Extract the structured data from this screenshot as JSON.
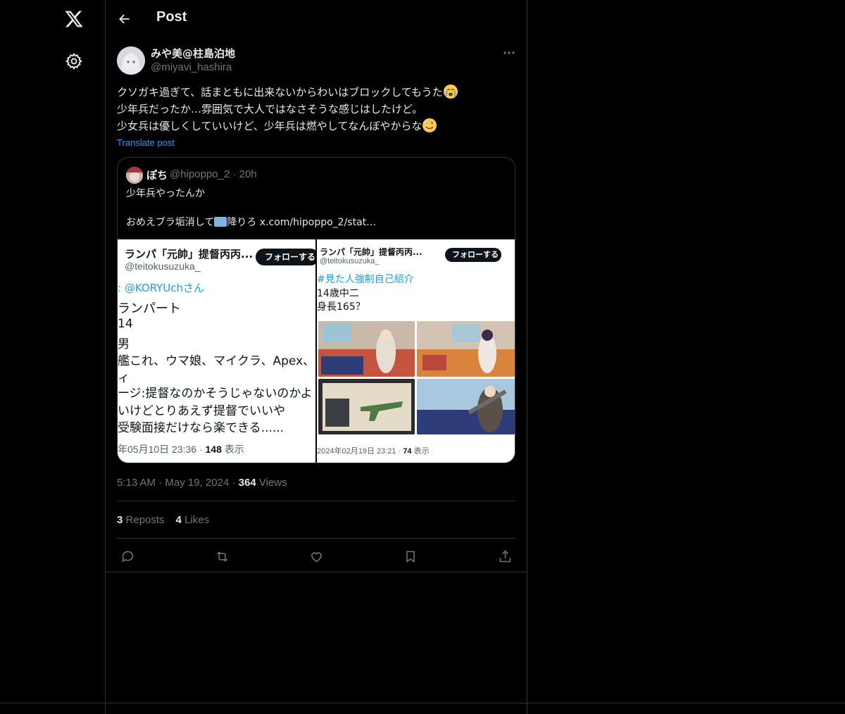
{
  "header": {
    "title": "Post"
  },
  "author": {
    "name": "みや美@柱島泊地",
    "handle": "@miyavi_hashira"
  },
  "post": {
    "lines": [
      "クソガキ過ぎて、話まともに出来ないからわいはブロックしてもうた",
      "少年兵だったか…雰囲気で大人ではなさそうな感じはしたけど。",
      "少女兵は優しくしていいけど、少年兵は燃やしてなんぼやからな"
    ],
    "translate_label": "Translate post"
  },
  "quote": {
    "name": "ぽち",
    "handle": "@hipoppo_2",
    "age": "20h",
    "line1": "少年兵やったんか",
    "line2_prefix": "おめえブラ垢消して",
    "line2_suffix": "降りろ",
    "link": "x.com/hipoppo_2/stat…",
    "left_shot": {
      "title": "ランパ「元帥」提督丙丙...",
      "handle": "@teitokusuzuka_",
      "follow": "フォローする",
      "reply": ": @KORYUchさん",
      "lines": [
        "ランパート",
        "14",
        "男",
        "艦これ、ウマ娘、マイクラ、Apex、",
        "ィ",
        "ージ:提督なのかそうじゃないのかよ",
        "いけどとりあえず提督でいいや",
        "受験面接だけなら楽できる......"
      ],
      "date": "年05月10日 23:36 · ",
      "views": "148",
      "views_label": " 表示"
    },
    "right_shot": {
      "title": "ランパ「元帥」提督丙丙...",
      "handle": "@teitokusuzuka_",
      "follow": "フォローする",
      "hashtag": "#見た人強制自己紹介",
      "lines": [
        "14歳中二",
        "身長165？"
      ],
      "date": "2024年02月19日 23:21 · ",
      "views": "74",
      "views_label": " 表示"
    }
  },
  "meta": {
    "time": "5:13 AM",
    "date": "May 19, 2024",
    "views": "364",
    "views_label": "Views"
  },
  "stats": {
    "reposts": "3",
    "reposts_label": "Reposts",
    "likes": "4",
    "likes_label": "Likes"
  },
  "icons": [
    "x-logo-icon",
    "gear-icon",
    "back-arrow-icon",
    "more-icon",
    "reply-icon",
    "repost-icon",
    "like-icon",
    "bookmark-icon",
    "share-icon"
  ],
  "colors": {
    "background": "#000000",
    "text": "#e7e9ea",
    "muted": "#71767b",
    "accent": "#1d9bf0",
    "border": "#2f3336"
  }
}
